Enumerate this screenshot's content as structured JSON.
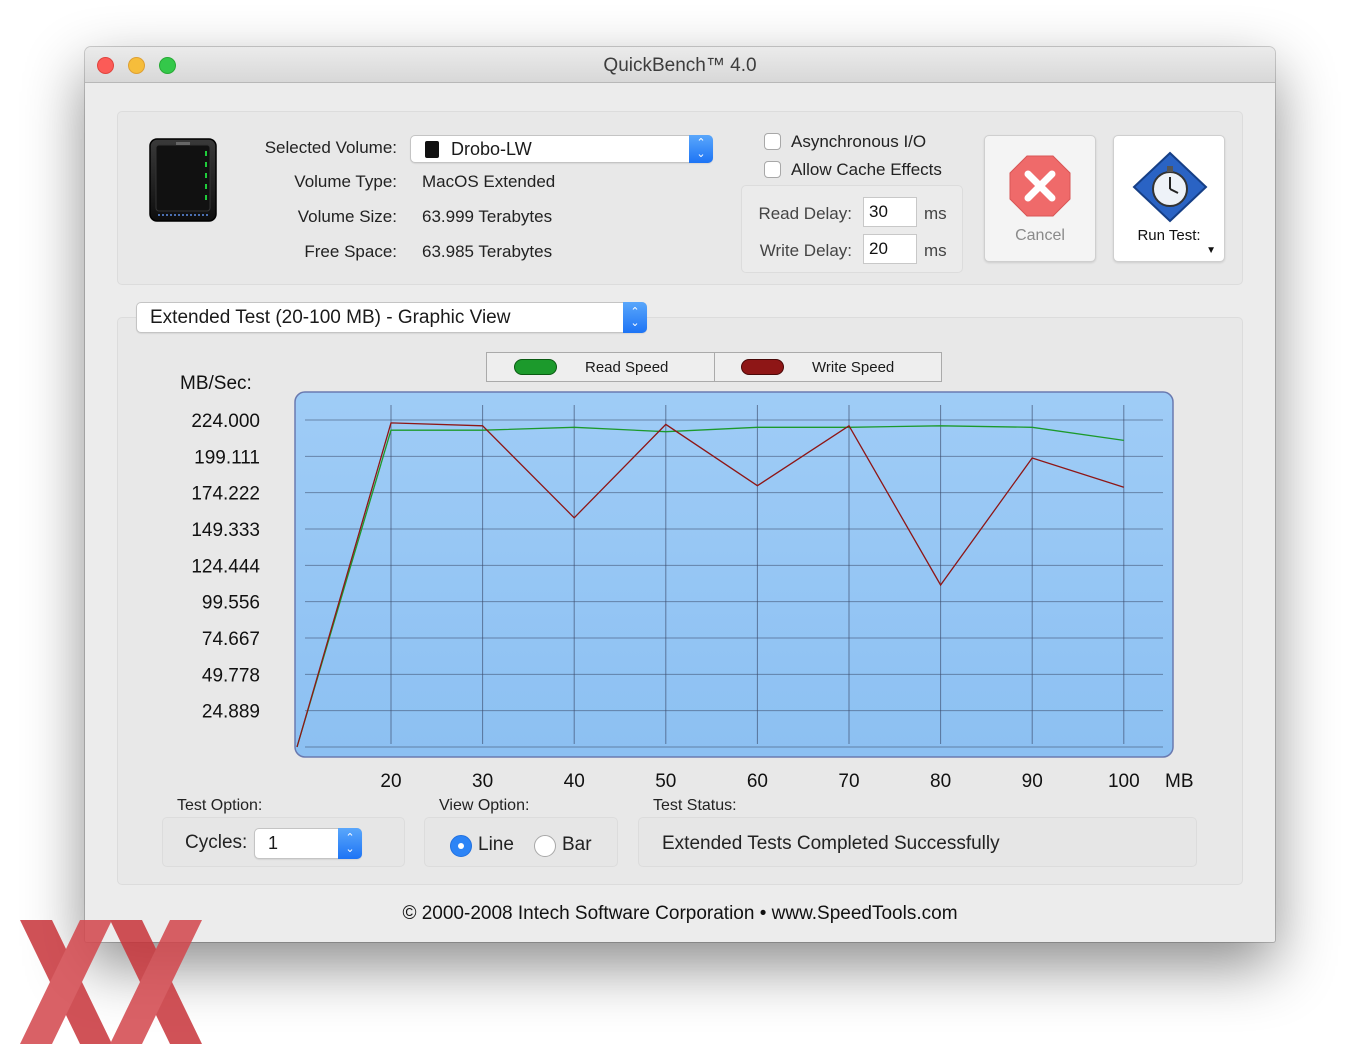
{
  "window": {
    "title": "QuickBench™ 4.0"
  },
  "volume": {
    "selected_label": "Selected Volume:",
    "selected_value": "Drobo-LW",
    "type_label": "Volume Type:",
    "type_value": "MacOS Extended",
    "size_label": "Volume Size:",
    "size_value": "63.999 Terabytes",
    "free_label": "Free Space:",
    "free_value": "63.985 Terabytes"
  },
  "options": {
    "async_label": "Asynchronous I/O",
    "async_checked": false,
    "cache_label": "Allow Cache Effects",
    "cache_checked": false,
    "read_delay_label": "Read Delay:",
    "read_delay_value": "30",
    "read_delay_unit": "ms",
    "write_delay_label": "Write Delay:",
    "write_delay_value": "20",
    "write_delay_unit": "ms"
  },
  "buttons": {
    "cancel_label": "Cancel",
    "run_label": "Run Test:"
  },
  "test_mode": {
    "selected": "Extended Test (20-100 MB) - Graphic View"
  },
  "legend": {
    "read_label": "Read Speed",
    "write_label": "Write Speed"
  },
  "colors": {
    "read": "#1c9a2c",
    "write": "#8e1616",
    "plot_bg": "#94c4f4",
    "grid": "#3a4a6a"
  },
  "chart_data": {
    "type": "line",
    "ylabel": "MB/Sec:",
    "xunit": "MB",
    "x_ticks": [
      "20",
      "30",
      "40",
      "50",
      "60",
      "70",
      "80",
      "90",
      "100"
    ],
    "y_ticks": [
      "224.000",
      "199.111",
      "174.222",
      "149.333",
      "124.444",
      "99.556",
      "74.667",
      "49.778",
      "24.889"
    ],
    "xlim": [
      9.5,
      105.5
    ],
    "ylim": [
      0,
      224
    ],
    "grid": true,
    "legend_position": "top",
    "series": [
      {
        "name": "Read Speed",
        "x": [
          10,
          20,
          30,
          40,
          50,
          60,
          70,
          80,
          90,
          100
        ],
        "y": [
          0,
          217,
          217,
          219,
          216,
          219,
          219,
          220,
          219,
          210
        ]
      },
      {
        "name": "Write Speed",
        "x": [
          10,
          20,
          30,
          40,
          50,
          60,
          70,
          80,
          90,
          100
        ],
        "y": [
          0,
          222,
          220,
          157,
          221,
          179,
          220,
          111,
          198,
          178
        ]
      }
    ]
  },
  "bottom": {
    "test_option_label": "Test Option:",
    "cycles_label": "Cycles:",
    "cycles_value": "1",
    "view_option_label": "View Option:",
    "line_label": "Line",
    "bar_label": "Bar",
    "view_selected": "Line",
    "status_label": "Test Status:",
    "status_value": "Extended Tests Completed Successfully"
  },
  "footer": {
    "copyright": "© 2000-2008 Intech Software Corporation • www.SpeedTools.com"
  }
}
